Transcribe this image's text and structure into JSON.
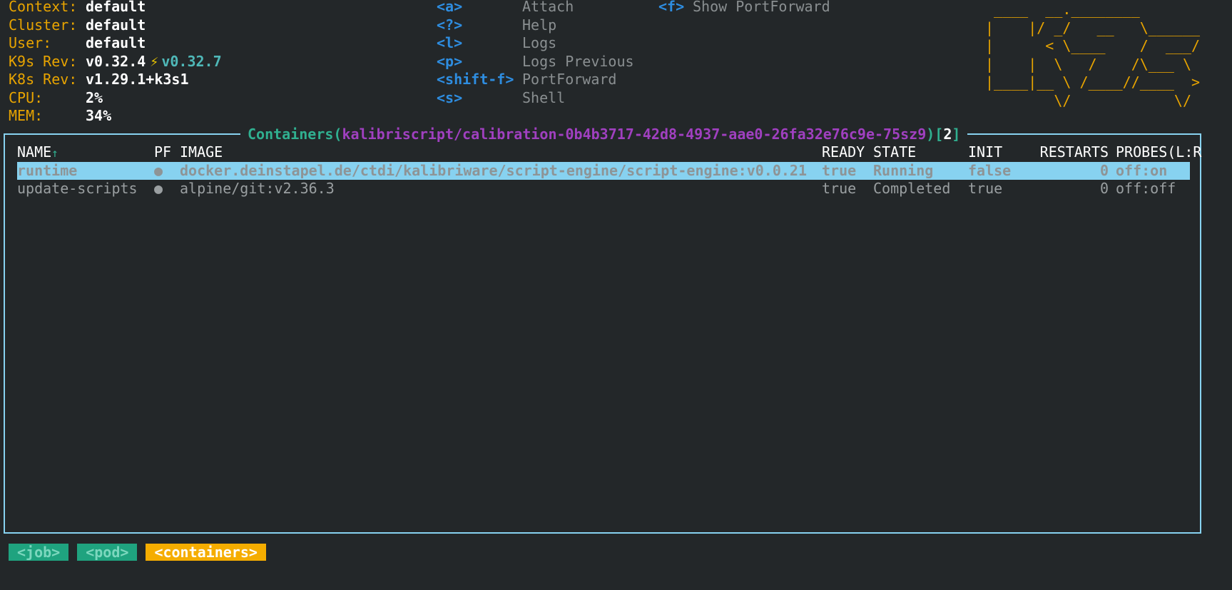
{
  "header": {
    "info": [
      {
        "key": "Context:",
        "value": "default"
      },
      {
        "key": "Cluster:",
        "value": "default"
      },
      {
        "key": "User:",
        "value": "default"
      },
      {
        "key": "K9s Rev:",
        "value": "v0.32.4",
        "update_icon": "lightning-icon",
        "update_version": "v0.32.7"
      },
      {
        "key": "K8s Rev:",
        "value": "v1.29.1+k3s1"
      },
      {
        "key": "CPU:",
        "value": "2%"
      },
      {
        "key": "MEM:",
        "value": "34%"
      }
    ],
    "hotkeys": [
      {
        "key": "<a>",
        "desc": "Attach"
      },
      {
        "key": "<?>",
        "desc": "Help"
      },
      {
        "key": "<l>",
        "desc": "Logs"
      },
      {
        "key": "<p>",
        "desc": "Logs Previous"
      },
      {
        "key": "<shift-f>",
        "desc": "PortForward"
      },
      {
        "key": "<s>",
        "desc": "Shell"
      }
    ],
    "hotkeys2": [
      {
        "key": "<f>",
        "desc": "Show PortForward"
      }
    ],
    "logo": " ____  __.________       \n|    |/ _/   __   \\______\n|      < \\____    /  ___/\n|    |  \\   /    /\\___ \\ \n|____|__ \\ /____//____  >\n        \\/            \\/ "
  },
  "table": {
    "title_prefix": "Containers(",
    "title_path": "kalibriscript/calibration-0b4b3717-42d8-4937-aae0-26fa32e76c9e-75sz9",
    "title_mid": ")[",
    "title_count": "2",
    "title_suffix": "]",
    "columns": {
      "name": "NAME",
      "sort_icon": "↑",
      "pf": "PF",
      "image": "IMAGE",
      "ready": "READY",
      "state": "STATE",
      "init": "INIT",
      "restarts": "RESTARTS",
      "probes": "PROBES(L:R"
    },
    "rows": [
      {
        "name": "runtime",
        "pf": "●",
        "image": "docker.deinstapel.de/ctdi/kalibriware/script-engine/script-engine:v0.0.21",
        "ready": "true",
        "state": "Running",
        "init": "false",
        "restarts": "0",
        "probes": "off:on",
        "selected": true
      },
      {
        "name": "update-scripts",
        "pf": "●",
        "image": "alpine/git:v2.36.3",
        "ready": "true",
        "state": "Completed",
        "init": "true",
        "restarts": "0",
        "probes": "off:off",
        "selected": false
      }
    ]
  },
  "breadcrumbs": [
    {
      "label": "<job>",
      "active": false
    },
    {
      "label": "<pod>",
      "active": false
    },
    {
      "label": "<containers>",
      "active": true
    }
  ],
  "colors": {
    "background": "#232729",
    "accent_orange": "#e8a400",
    "accent_blue": "#2e8de0",
    "frame": "#87d2f0",
    "title_green": "#30b090",
    "title_purple": "#a040c0"
  }
}
